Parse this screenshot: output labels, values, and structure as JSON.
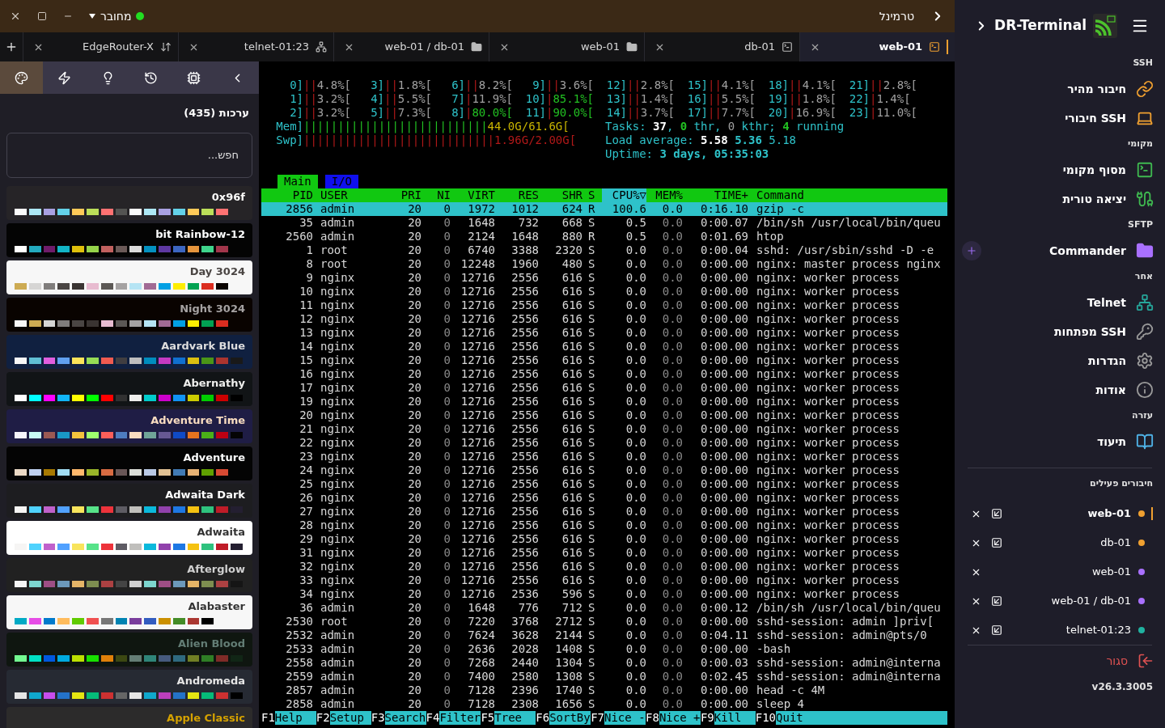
{
  "top_bar": {
    "title": "טרמינל",
    "status": "מחובר",
    "connected": true
  },
  "tabs": [
    {
      "label": "EdgeRouter-X",
      "kind": "arrows",
      "selected": false
    },
    {
      "label": "telnet-01:23",
      "kind": "network",
      "selected": false
    },
    {
      "label": "web-01 / db-01",
      "kind": "folder",
      "selected": false
    },
    {
      "label": "web-01",
      "kind": "folder",
      "selected": false
    },
    {
      "label": "db-01",
      "kind": "terminal",
      "selected": false
    },
    {
      "label": "web-01",
      "kind": "terminal",
      "selected": true
    }
  ],
  "theme_panel": {
    "tools": [
      {
        "kind": "palette",
        "selected": true
      },
      {
        "kind": "bolt",
        "selected": false
      },
      {
        "kind": "bulb",
        "selected": false
      },
      {
        "kind": "history",
        "selected": false
      },
      {
        "kind": "cpu",
        "selected": false
      },
      {
        "kind": "back",
        "selected": false
      }
    ],
    "heading": "ערכות (435)",
    "search_placeholder": "חפש...",
    "themes": [
      {
        "name": "0x96f",
        "color": "#262427",
        "foreground": {
          "color": "#fcfcfa"
        },
        "swatches": [
          {
            "color": "#fcfcfa"
          },
          {
            "color": "#aee8f4"
          },
          {
            "color": "#a9a1e1"
          },
          {
            "color": "#64d2e8"
          },
          {
            "color": "#ffca58"
          },
          {
            "color": "#bcdf59"
          },
          {
            "color": "#ff7272"
          },
          {
            "color": "#545452"
          },
          {
            "color": "#fcfcfa"
          },
          {
            "color": "#aee8f4"
          },
          {
            "color": "#a9a1e1"
          },
          {
            "color": "#64d2e8"
          },
          {
            "color": "#ffca58"
          },
          {
            "color": "#bcdf59"
          },
          {
            "color": "#ff7272"
          }
        ]
      },
      {
        "name": "bit Rainbow-12",
        "color": "#040404",
        "foreground": {
          "color": "#feffff"
        },
        "swatches": [
          {
            "color": "#ffffff"
          },
          {
            "color": "#23aabf"
          },
          {
            "color": "#6f1c6a"
          },
          {
            "color": "#12b5c6"
          },
          {
            "color": "#dfc00b"
          },
          {
            "color": "#95d34a"
          },
          {
            "color": "#c1615f"
          },
          {
            "color": "#6b5a58"
          },
          {
            "color": "#dbdbdb"
          },
          {
            "color": "#0391c0"
          },
          {
            "color": "#5e38a2"
          },
          {
            "color": "#3c66c1"
          },
          {
            "color": "#e5953d"
          },
          {
            "color": "#3fd58c"
          },
          {
            "color": "#a2364b"
          }
        ]
      },
      {
        "name": "Day 3024",
        "color": "#f7f7f7",
        "foreground": {
          "color": "#4a4543"
        },
        "swatches": [
          {
            "color": "#cdab53"
          },
          {
            "color": "#d6d5d4"
          },
          {
            "color": "#807d7c"
          },
          {
            "color": "#4a4543"
          },
          {
            "color": "#3a3432"
          },
          {
            "color": "#e8bbd0"
          },
          {
            "color": "#5c5855"
          },
          {
            "color": "#a5a2a2"
          },
          {
            "color": "#b5e4f4"
          },
          {
            "color": "#a16a94"
          },
          {
            "color": "#01a0e4"
          },
          {
            "color": "#fded02"
          },
          {
            "color": "#01a252"
          },
          {
            "color": "#db2d20"
          },
          {
            "color": "#090300"
          }
        ]
      },
      {
        "name": "Night 3024",
        "color": "#090300",
        "foreground": {
          "color": "#a5a2a2"
        },
        "swatches": [
          {
            "color": "#f7f7f7"
          },
          {
            "color": "#cdab53"
          },
          {
            "color": "#d6d5d4"
          },
          {
            "color": "#807d7c"
          },
          {
            "color": "#4a4543"
          },
          {
            "color": "#3a3432"
          },
          {
            "color": "#e8bbd0"
          },
          {
            "color": "#5c5855"
          },
          {
            "color": "#a5a2a2"
          },
          {
            "color": "#b5e4f4"
          },
          {
            "color": "#a16a94"
          },
          {
            "color": "#01a0e4"
          },
          {
            "color": "#fded02"
          },
          {
            "color": "#01a252"
          },
          {
            "color": "#db2d20"
          }
        ]
      },
      {
        "name": "Aardvark Blue",
        "color": "#102040",
        "foreground": {
          "color": "#dddddd"
        },
        "swatches": [
          {
            "color": "#f7f7f7"
          },
          {
            "color": "#60bfd4"
          },
          {
            "color": "#e05ede"
          },
          {
            "color": "#60a0f0"
          },
          {
            "color": "#fae359"
          },
          {
            "color": "#95dc55"
          },
          {
            "color": "#f05b50"
          },
          {
            "color": "#403e41"
          },
          {
            "color": "#bebebe"
          },
          {
            "color": "#008dbe"
          },
          {
            "color": "#c43ac3"
          },
          {
            "color": "#1070d0"
          },
          {
            "color": "#dbbf10"
          },
          {
            "color": "#4a9617"
          },
          {
            "color": "#aa342e"
          },
          {
            "color": "#191919"
          }
        ]
      },
      {
        "name": "Abernathy",
        "color": "#111416",
        "foreground": {
          "color": "#eeeeec"
        },
        "swatches": [
          {
            "color": "#ffffff"
          },
          {
            "color": "#00ffff"
          },
          {
            "color": "#ff00ff"
          },
          {
            "color": "#11b5f6"
          },
          {
            "color": "#ffff00"
          },
          {
            "color": "#00ff00"
          },
          {
            "color": "#ff0000"
          },
          {
            "color": "#313131"
          },
          {
            "color": "#eeeeec"
          },
          {
            "color": "#00cccc"
          },
          {
            "color": "#cc00cc"
          },
          {
            "color": "#1093f5"
          },
          {
            "color": "#cccc00"
          },
          {
            "color": "#00cd00"
          },
          {
            "color": "#cd0000"
          },
          {
            "color": "#000000"
          }
        ]
      },
      {
        "name": "Adventure Time",
        "color": "#1f1d45",
        "foreground": {
          "color": "#f8dcc0"
        },
        "swatches": [
          {
            "color": "#f6f5fb"
          },
          {
            "color": "#c8faf4"
          },
          {
            "color": "#9b5953"
          },
          {
            "color": "#1997c6"
          },
          {
            "color": "#f3c23d"
          },
          {
            "color": "#9eff6e"
          },
          {
            "color": "#fc5f5a"
          },
          {
            "color": "#4e7cbf"
          },
          {
            "color": "#f8dcc0"
          },
          {
            "color": "#70a598"
          },
          {
            "color": "#665993"
          },
          {
            "color": "#0f4ac6"
          },
          {
            "color": "#e7741e"
          },
          {
            "color": "#4ab118"
          },
          {
            "color": "#bd0013"
          },
          {
            "color": "#050404"
          }
        ]
      },
      {
        "name": "Adventure",
        "color": "#040404",
        "foreground": {
          "color": "#feffff"
        },
        "swatches": [
          {
            "color": "#ebd9c5"
          },
          {
            "color": "#bed0ef"
          },
          {
            "color": "#a67902"
          },
          {
            "color": "#a0dcf2"
          },
          {
            "color": "#feb86c"
          },
          {
            "color": "#99b529"
          },
          {
            "color": "#d76b42"
          },
          {
            "color": "#685656"
          },
          {
            "color": "#dbded8"
          },
          {
            "color": "#b9c9e4"
          },
          {
            "color": "#e1c193"
          },
          {
            "color": "#417ab3"
          },
          {
            "color": "#e7b274"
          },
          {
            "color": "#60a001"
          },
          {
            "color": "#d84a33"
          }
        ]
      },
      {
        "name": "Adwaita Dark",
        "color": "#1d1d20",
        "foreground": {
          "color": "#ffffff"
        },
        "swatches": [
          {
            "color": "#f6f5f4"
          },
          {
            "color": "#4fd2fd"
          },
          {
            "color": "#c061cb"
          },
          {
            "color": "#51a1ff"
          },
          {
            "color": "#f8e45c"
          },
          {
            "color": "#57e389"
          },
          {
            "color": "#ed333b"
          },
          {
            "color": "#5e5c64"
          },
          {
            "color": "#c0bfbc"
          },
          {
            "color": "#0ab9dc"
          },
          {
            "color": "#9141ac"
          },
          {
            "color": "#1e78e4"
          },
          {
            "color": "#f5c211"
          },
          {
            "color": "#2ec27e"
          },
          {
            "color": "#c01c28"
          },
          {
            "color": "#241f31"
          }
        ]
      },
      {
        "name": "Adwaita",
        "color": "#ffffff",
        "foreground": {
          "color": "#333333"
        },
        "swatches": [
          {
            "color": "#f6f5f4"
          },
          {
            "color": "#4fd2fd"
          },
          {
            "color": "#c061cb"
          },
          {
            "color": "#51a1ff"
          },
          {
            "color": "#f8e45c"
          },
          {
            "color": "#57e389"
          },
          {
            "color": "#ed333b"
          },
          {
            "color": "#5e5c64"
          },
          {
            "color": "#c0bfbc"
          },
          {
            "color": "#0ab9dc"
          },
          {
            "color": "#9141ac"
          },
          {
            "color": "#1e78e4"
          },
          {
            "color": "#f5c211"
          },
          {
            "color": "#2ec27e"
          },
          {
            "color": "#c01c28"
          },
          {
            "color": "#241f31"
          }
        ]
      },
      {
        "name": "Afterglow",
        "color": "#212121",
        "foreground": {
          "color": "#d0d0d0"
        },
        "swatches": [
          {
            "color": "#f5f5f5"
          },
          {
            "color": "#7dd6cf"
          },
          {
            "color": "#9e4e85"
          },
          {
            "color": "#6c99bb"
          },
          {
            "color": "#e5b567"
          },
          {
            "color": "#7e8e50"
          },
          {
            "color": "#ac4142"
          },
          {
            "color": "#444444"
          },
          {
            "color": "#d0d0d0"
          },
          {
            "color": "#7dd6cf"
          },
          {
            "color": "#9e4e85"
          },
          {
            "color": "#6c99bb"
          },
          {
            "color": "#e5b567"
          },
          {
            "color": "#7e8e50"
          },
          {
            "color": "#ac4142"
          },
          {
            "color": "#151515"
          }
        ]
      },
      {
        "name": "Alabaster",
        "color": "#f7f7f7",
        "foreground": {
          "color": "#333333"
        },
        "swatches": [
          {
            "color": "#00aac5"
          },
          {
            "color": "#e64ce6"
          },
          {
            "color": "#007acc"
          },
          {
            "color": "#ffbc5d"
          },
          {
            "color": "#60cb00"
          },
          {
            "color": "#f05050"
          },
          {
            "color": "#777777"
          },
          {
            "color": "#0083b2"
          },
          {
            "color": "#7a3e9d"
          },
          {
            "color": "#325cc0"
          },
          {
            "color": "#cb9000"
          },
          {
            "color": "#448c27"
          },
          {
            "color": "#aa3731"
          },
          {
            "color": "#000000"
          }
        ]
      },
      {
        "name": "Alien Blood",
        "color": "#0f1610",
        "foreground": {
          "color": "#637d75"
        },
        "swatches": [
          {
            "color": "#73fa91"
          },
          {
            "color": "#00e0c4"
          },
          {
            "color": "#0058e0"
          },
          {
            "color": "#00aae0"
          },
          {
            "color": "#bde000"
          },
          {
            "color": "#18e000"
          },
          {
            "color": "#e08009"
          },
          {
            "color": "#3c4812"
          },
          {
            "color": "#647d75"
          },
          {
            "color": "#2f8579"
          },
          {
            "color": "#465a7d"
          },
          {
            "color": "#2f6a7f"
          },
          {
            "color": "#717f24"
          },
          {
            "color": "#2f7e25"
          },
          {
            "color": "#7f2b27"
          },
          {
            "color": "#112616"
          }
        ]
      },
      {
        "name": "Andromeda",
        "color": "#262a33",
        "foreground": {
          "color": "#e5e5e5"
        },
        "swatches": [
          {
            "color": "#e5e5e5"
          },
          {
            "color": "#0fa8cd"
          },
          {
            "color": "#c74ded"
          },
          {
            "color": "#2472c8"
          },
          {
            "color": "#e5e512"
          },
          {
            "color": "#05bc79"
          },
          {
            "color": "#cd3131"
          },
          {
            "color": "#666666"
          },
          {
            "color": "#e5e5e5"
          },
          {
            "color": "#0fa8cd"
          },
          {
            "color": "#bc3fbc"
          },
          {
            "color": "#2472c8"
          },
          {
            "color": "#e5e512"
          },
          {
            "color": "#05bc79"
          },
          {
            "color": "#cd3131"
          },
          {
            "color": "#000000"
          }
        ]
      },
      {
        "name": "Apple Classic",
        "color": "#2c2b2b",
        "foreground": {
          "color": "#d5a200"
        }
      }
    ]
  },
  "htop": {
    "cpu_lines": [
      [
        {
          "label": "0]",
          "bars": "||",
          "value": "4.8%[",
          "color": "#a0a0a0"
        },
        {
          "label": "3]",
          "bars": "||",
          "value": "1.8%[",
          "color": "#a0a0a0"
        },
        {
          "label": "6]",
          "bars": "||",
          "value": "8.2%[",
          "color": "#a0a0a0"
        },
        {
          "label": "9]",
          "bars": "||",
          "value": "3.6%[",
          "color": "#a0a0a0"
        },
        {
          "label": "12]",
          "bars": "||",
          "value": "2.8%[",
          "color": "#a0a0a0"
        },
        {
          "label": "15]",
          "bars": "||",
          "value": "4.1%[",
          "color": "#a0a0a0"
        },
        {
          "label": "18]",
          "bars": "||",
          "value": "4.1%[",
          "color": "#a0a0a0"
        },
        {
          "label": "21]",
          "bars": "||",
          "value": "2.8%[",
          "color": "#a0a0a0"
        }
      ],
      [
        {
          "label": "1]",
          "bars": "||",
          "value": "3.2%[",
          "color": "#a0a0a0"
        },
        {
          "label": "4]",
          "bars": "||",
          "value": "5.5%[",
          "color": "#a0a0a0"
        },
        {
          "label": "7]",
          "bars": "|",
          "value": "11.9%[",
          "color": "#a0a0a0"
        },
        {
          "label": "10]",
          "bars": "|",
          "value": "85.1%[",
          "color": "#22c022"
        },
        {
          "label": "13]",
          "bars": "||",
          "value": "1.4%[",
          "color": "#a0a0a0"
        },
        {
          "label": "16]",
          "bars": "||",
          "value": "5.5%[",
          "color": "#a0a0a0"
        },
        {
          "label": "19]",
          "bars": "||",
          "value": "1.8%[",
          "color": "#a0a0a0"
        },
        {
          "label": "22]",
          "bars": "|",
          "value": "1.4%[",
          "color": "#a0a0a0"
        }
      ],
      [
        {
          "label": "2]",
          "bars": "||",
          "value": "3.2%[",
          "color": "#a0a0a0"
        },
        {
          "label": "5]",
          "bars": "||",
          "value": "7.3%[",
          "color": "#a0a0a0"
        },
        {
          "label": "8]",
          "bars": "|",
          "value": "80.0%[",
          "color": "#22c022"
        },
        {
          "label": "11]",
          "bars": "|",
          "value": "90.0%[",
          "color": "#22c022"
        },
        {
          "label": "14]",
          "bars": "||",
          "value": "3.7%[",
          "color": "#a0a0a0"
        },
        {
          "label": "17]",
          "bars": "||",
          "value": "7.7%[",
          "color": "#a0a0a0"
        },
        {
          "label": "20]",
          "bars": "|",
          "value": "16.9%[",
          "color": "#a0a0a0"
        },
        {
          "label": "23]",
          "bars": "|",
          "value": "11.0%[",
          "color": "#a0a0a0"
        }
      ]
    ],
    "memory_lines": [
      {
        "label": "Mem]",
        "bar": {
          "text": "|||||||||||||||||||||||||||",
          "color": "#22c022"
        },
        "value": "44.0G/61.6G[",
        "color": "#c8b400"
      },
      {
        "label": "Swp]",
        "bar": {
          "text": "||||||||||||||||||||||||||||",
          "color": "#b01818"
        },
        "value": "1.96G/2.00G[",
        "color": "#b01818"
      }
    ],
    "info_lines": [
      [
        {
          "text": "Tasks: ",
          "color": "#2ec2c9",
          "bold": false
        },
        {
          "text": "37",
          "color": "#ffffff",
          "bold": true
        },
        {
          "text": ", ",
          "color": "#2ec2c9",
          "bold": false
        },
        {
          "text": "0",
          "color": "#22c022",
          "bold": true
        },
        {
          "text": " thr, ",
          "color": "#2ec2c9",
          "bold": false
        },
        {
          "text": "0",
          "color": "#a0a0a0",
          "bold": false
        },
        {
          "text": " kthr; ",
          "color": "#2ec2c9",
          "bold": false
        },
        {
          "text": "4",
          "color": "#22c022",
          "bold": true
        },
        {
          "text": " running",
          "color": "#2ec2c9",
          "bold": false
        }
      ],
      [
        {
          "text": "Load average: ",
          "color": "#2ec2c9",
          "bold": false
        },
        {
          "text": "5.58 ",
          "color": "#ffffff",
          "bold": true
        },
        {
          "text": "5.36 ",
          "color": "#2ec2c9",
          "bold": true
        },
        {
          "text": "5.18",
          "color": "#2ec2c9",
          "bold": false
        }
      ],
      [
        {
          "text": "Uptime: ",
          "color": "#2ec2c9",
          "bold": false
        },
        {
          "text": "3 days, 05:35:03",
          "color": "#2ec2c9",
          "bold": true
        }
      ]
    ],
    "screen_tabs": [
      {
        "label": "Main",
        "selected": true
      },
      {
        "label": "I/O",
        "selected": false
      }
    ],
    "columns": [
      {
        "label": "PID",
        "selected": false
      },
      {
        "label": "USER",
        "selected": false
      },
      {
        "label": "PRI",
        "selected": false
      },
      {
        "label": "NI",
        "selected": false
      },
      {
        "label": "VIRT",
        "selected": false
      },
      {
        "label": "RES",
        "selected": false
      },
      {
        "label": "SHR",
        "selected": false
      },
      {
        "label": "S",
        "selected": false
      },
      {
        "label": "CPU%",
        "selected": true,
        "sort_icon": "▽"
      },
      {
        "label": "MEM%",
        "selected": false
      },
      {
        "label": "TIME+",
        "selected": false
      },
      {
        "label": "Command",
        "selected": false
      }
    ],
    "rows": [
      {
        "pid": "2856",
        "user": "admin",
        "pri": "20",
        "ni": "0",
        "virt": "1972",
        "res": "1012",
        "shr": "624",
        "s": "R",
        "cpu": "100.6",
        "mem": "0.0",
        "time": "0:16.10",
        "command": "gzip -c",
        "selected": true
      },
      {
        "pid": "35",
        "user": "admin",
        "pri": "20",
        "ni": "0",
        "virt": "1648",
        "res": "732",
        "shr": "668",
        "s": "S",
        "cpu": "0.5",
        "mem": "0.0",
        "time": "0:00.07",
        "command": "/bin/sh /usr/local/bin/queu",
        "selected": false
      },
      {
        "pid": "2560",
        "user": "admin",
        "pri": "20",
        "ni": "0",
        "virt": "2124",
        "res": "1648",
        "shr": "880",
        "s": "R",
        "cpu": "0.5",
        "mem": "0.0",
        "time": "0:01.69",
        "command": "htop",
        "selected": false
      },
      {
        "pid": "1",
        "user": "root",
        "pri": "20",
        "ni": "0",
        "virt": "6740",
        "res": "3388",
        "shr": "2320",
        "s": "S",
        "cpu": "0.0",
        "mem": "0.0",
        "time": "0:00.04",
        "command": "sshd: /usr/sbin/sshd -D -e",
        "selected": false
      },
      {
        "pid": "8",
        "user": "root",
        "pri": "20",
        "ni": "0",
        "virt": "12248",
        "res": "1960",
        "shr": "480",
        "s": "S",
        "cpu": "0.0",
        "mem": "0.0",
        "time": "0:00.00",
        "command": "nginx: master process nginx",
        "selected": false
      },
      {
        "pid": "9",
        "user": "nginx",
        "pri": "20",
        "ni": "0",
        "virt": "12716",
        "res": "2556",
        "shr": "616",
        "s": "S",
        "cpu": "0.0",
        "mem": "0.0",
        "time": "0:00.00",
        "command": "nginx: worker process",
        "selected": false
      },
      {
        "pid": "10",
        "user": "nginx",
        "pri": "20",
        "ni": "0",
        "virt": "12716",
        "res": "2556",
        "shr": "616",
        "s": "S",
        "cpu": "0.0",
        "mem": "0.0",
        "time": "0:00.00",
        "command": "nginx: worker process",
        "selected": false
      },
      {
        "pid": "11",
        "user": "nginx",
        "pri": "20",
        "ni": "0",
        "virt": "12716",
        "res": "2556",
        "shr": "616",
        "s": "S",
        "cpu": "0.0",
        "mem": "0.0",
        "time": "0:00.00",
        "command": "nginx: worker process",
        "selected": false
      },
      {
        "pid": "12",
        "user": "nginx",
        "pri": "20",
        "ni": "0",
        "virt": "12716",
        "res": "2556",
        "shr": "616",
        "s": "S",
        "cpu": "0.0",
        "mem": "0.0",
        "time": "0:00.00",
        "command": "nginx: worker process",
        "selected": false
      },
      {
        "pid": "13",
        "user": "nginx",
        "pri": "20",
        "ni": "0",
        "virt": "12716",
        "res": "2556",
        "shr": "616",
        "s": "S",
        "cpu": "0.0",
        "mem": "0.0",
        "time": "0:00.00",
        "command": "nginx: worker process",
        "selected": false
      },
      {
        "pid": "14",
        "user": "nginx",
        "pri": "20",
        "ni": "0",
        "virt": "12716",
        "res": "2556",
        "shr": "616",
        "s": "S",
        "cpu": "0.0",
        "mem": "0.0",
        "time": "0:00.00",
        "command": "nginx: worker process",
        "selected": false
      },
      {
        "pid": "15",
        "user": "nginx",
        "pri": "20",
        "ni": "0",
        "virt": "12716",
        "res": "2556",
        "shr": "616",
        "s": "S",
        "cpu": "0.0",
        "mem": "0.0",
        "time": "0:00.00",
        "command": "nginx: worker process",
        "selected": false
      },
      {
        "pid": "16",
        "user": "nginx",
        "pri": "20",
        "ni": "0",
        "virt": "12716",
        "res": "2556",
        "shr": "616",
        "s": "S",
        "cpu": "0.0",
        "mem": "0.0",
        "time": "0:00.00",
        "command": "nginx: worker process",
        "selected": false
      },
      {
        "pid": "17",
        "user": "nginx",
        "pri": "20",
        "ni": "0",
        "virt": "12716",
        "res": "2556",
        "shr": "616",
        "s": "S",
        "cpu": "0.0",
        "mem": "0.0",
        "time": "0:00.00",
        "command": "nginx: worker process",
        "selected": false
      },
      {
        "pid": "19",
        "user": "nginx",
        "pri": "20",
        "ni": "0",
        "virt": "12716",
        "res": "2556",
        "shr": "616",
        "s": "S",
        "cpu": "0.0",
        "mem": "0.0",
        "time": "0:00.00",
        "command": "nginx: worker process",
        "selected": false
      },
      {
        "pid": "20",
        "user": "nginx",
        "pri": "20",
        "ni": "0",
        "virt": "12716",
        "res": "2556",
        "shr": "616",
        "s": "S",
        "cpu": "0.0",
        "mem": "0.0",
        "time": "0:00.00",
        "command": "nginx: worker process",
        "selected": false
      },
      {
        "pid": "21",
        "user": "nginx",
        "pri": "20",
        "ni": "0",
        "virt": "12716",
        "res": "2556",
        "shr": "616",
        "s": "S",
        "cpu": "0.0",
        "mem": "0.0",
        "time": "0:00.00",
        "command": "nginx: worker process",
        "selected": false
      },
      {
        "pid": "22",
        "user": "nginx",
        "pri": "20",
        "ni": "0",
        "virt": "12716",
        "res": "2556",
        "shr": "616",
        "s": "S",
        "cpu": "0.0",
        "mem": "0.0",
        "time": "0:00.00",
        "command": "nginx: worker process",
        "selected": false
      },
      {
        "pid": "23",
        "user": "nginx",
        "pri": "20",
        "ni": "0",
        "virt": "12716",
        "res": "2556",
        "shr": "616",
        "s": "S",
        "cpu": "0.0",
        "mem": "0.0",
        "time": "0:00.00",
        "command": "nginx: worker process",
        "selected": false
      },
      {
        "pid": "24",
        "user": "nginx",
        "pri": "20",
        "ni": "0",
        "virt": "12716",
        "res": "2556",
        "shr": "616",
        "s": "S",
        "cpu": "0.0",
        "mem": "0.0",
        "time": "0:00.00",
        "command": "nginx: worker process",
        "selected": false
      },
      {
        "pid": "25",
        "user": "nginx",
        "pri": "20",
        "ni": "0",
        "virt": "12716",
        "res": "2556",
        "shr": "616",
        "s": "S",
        "cpu": "0.0",
        "mem": "0.0",
        "time": "0:00.00",
        "command": "nginx: worker process",
        "selected": false
      },
      {
        "pid": "26",
        "user": "nginx",
        "pri": "20",
        "ni": "0",
        "virt": "12716",
        "res": "2556",
        "shr": "616",
        "s": "S",
        "cpu": "0.0",
        "mem": "0.0",
        "time": "0:00.00",
        "command": "nginx: worker process",
        "selected": false
      },
      {
        "pid": "27",
        "user": "nginx",
        "pri": "20",
        "ni": "0",
        "virt": "12716",
        "res": "2556",
        "shr": "616",
        "s": "S",
        "cpu": "0.0",
        "mem": "0.0",
        "time": "0:00.00",
        "command": "nginx: worker process",
        "selected": false
      },
      {
        "pid": "28",
        "user": "nginx",
        "pri": "20",
        "ni": "0",
        "virt": "12716",
        "res": "2556",
        "shr": "616",
        "s": "S",
        "cpu": "0.0",
        "mem": "0.0",
        "time": "0:00.00",
        "command": "nginx: worker process",
        "selected": false
      },
      {
        "pid": "29",
        "user": "nginx",
        "pri": "20",
        "ni": "0",
        "virt": "12716",
        "res": "2556",
        "shr": "616",
        "s": "S",
        "cpu": "0.0",
        "mem": "0.0",
        "time": "0:00.00",
        "command": "nginx: worker process",
        "selected": false
      },
      {
        "pid": "31",
        "user": "nginx",
        "pri": "20",
        "ni": "0",
        "virt": "12716",
        "res": "2556",
        "shr": "616",
        "s": "S",
        "cpu": "0.0",
        "mem": "0.0",
        "time": "0:00.00",
        "command": "nginx: worker process",
        "selected": false
      },
      {
        "pid": "32",
        "user": "nginx",
        "pri": "20",
        "ni": "0",
        "virt": "12716",
        "res": "2556",
        "shr": "616",
        "s": "S",
        "cpu": "0.0",
        "mem": "0.0",
        "time": "0:00.00",
        "command": "nginx: worker process",
        "selected": false
      },
      {
        "pid": "33",
        "user": "nginx",
        "pri": "20",
        "ni": "0",
        "virt": "12716",
        "res": "2556",
        "shr": "616",
        "s": "S",
        "cpu": "0.0",
        "mem": "0.0",
        "time": "0:00.00",
        "command": "nginx: worker process",
        "selected": false
      },
      {
        "pid": "34",
        "user": "nginx",
        "pri": "20",
        "ni": "0",
        "virt": "12716",
        "res": "2536",
        "shr": "596",
        "s": "S",
        "cpu": "0.0",
        "mem": "0.0",
        "time": "0:00.00",
        "command": "nginx: worker process",
        "selected": false
      },
      {
        "pid": "36",
        "user": "admin",
        "pri": "20",
        "ni": "0",
        "virt": "1648",
        "res": "776",
        "shr": "712",
        "s": "S",
        "cpu": "0.0",
        "mem": "0.0",
        "time": "0:00.12",
        "command": "/bin/sh /usr/local/bin/queu",
        "selected": false
      },
      {
        "pid": "2530",
        "user": "root",
        "pri": "20",
        "ni": "0",
        "virt": "7220",
        "res": "3768",
        "shr": "2712",
        "s": "S",
        "cpu": "0.0",
        "mem": "0.0",
        "time": "0:00.00",
        "command": "sshd-session: admin ]priv[",
        "selected": false
      },
      {
        "pid": "2532",
        "user": "admin",
        "pri": "20",
        "ni": "0",
        "virt": "7624",
        "res": "3628",
        "shr": "2144",
        "s": "S",
        "cpu": "0.0",
        "mem": "0.0",
        "time": "0:04.11",
        "command": "sshd-session: admin@pts/0",
        "selected": false
      },
      {
        "pid": "2533",
        "user": "admin",
        "pri": "20",
        "ni": "0",
        "virt": "2636",
        "res": "2028",
        "shr": "1408",
        "s": "S",
        "cpu": "0.0",
        "mem": "0.0",
        "time": "0:00.00",
        "command": "-bash",
        "selected": false
      },
      {
        "pid": "2558",
        "user": "admin",
        "pri": "20",
        "ni": "0",
        "virt": "7268",
        "res": "2440",
        "shr": "1304",
        "s": "S",
        "cpu": "0.0",
        "mem": "0.0",
        "time": "0:00.03",
        "command": "sshd-session: admin@interna",
        "selected": false
      },
      {
        "pid": "2559",
        "user": "admin",
        "pri": "20",
        "ni": "0",
        "virt": "7400",
        "res": "2580",
        "shr": "1308",
        "s": "S",
        "cpu": "0.0",
        "mem": "0.0",
        "time": "0:02.45",
        "command": "sshd-session: admin@interna",
        "selected": false
      },
      {
        "pid": "2857",
        "user": "admin",
        "pri": "20",
        "ni": "0",
        "virt": "7128",
        "res": "2396",
        "shr": "1740",
        "s": "S",
        "cpu": "0.0",
        "mem": "0.0",
        "time": "0:00.00",
        "command": "head -c 4M",
        "selected": false
      },
      {
        "pid": "2858",
        "user": "admin",
        "pri": "20",
        "ni": "0",
        "virt": "7128",
        "res": "2308",
        "shr": "1656",
        "s": "S",
        "cpu": "0.0",
        "mem": "0.0",
        "time": "0:00.00",
        "command": "sleep 4",
        "selected": false
      }
    ],
    "function_keys": [
      {
        "key": "F1",
        "label": "Help"
      },
      {
        "key": "F2",
        "label": "Setup"
      },
      {
        "key": "F3",
        "label": "Search"
      },
      {
        "key": "F4",
        "label": "Filter"
      },
      {
        "key": "F5",
        "label": "Tree"
      },
      {
        "key": "F6",
        "label": "SortBy"
      },
      {
        "key": "F7",
        "label": "Nice -"
      },
      {
        "key": "F8",
        "label": "Nice +"
      },
      {
        "key": "F9",
        "label": "Kill"
      },
      {
        "key": "F10",
        "label": "Quit"
      }
    ]
  },
  "sidebar": {
    "title": "DR-Terminal",
    "sections": [
      {
        "heading": "SSH",
        "items": [
          {
            "label": "חיבור מהיר",
            "kind": "link",
            "color": "#f0a030"
          },
          {
            "label": "חיבורי SSH",
            "kind": "laptop",
            "color": "#f0a030"
          }
        ]
      },
      {
        "heading": "מקומי",
        "items": [
          {
            "label": "מסוף מקומי",
            "kind": "terminal",
            "color": "#3fb950"
          },
          {
            "label": "יציאה טורית",
            "kind": "cable",
            "color": "#3fb950"
          }
        ]
      },
      {
        "heading": "SFTP",
        "items": [
          {
            "label": "Commander",
            "kind": "folder",
            "color": "#a970ff",
            "add_button": true
          }
        ]
      },
      {
        "heading": "אחר",
        "items": [
          {
            "label": "Telnet",
            "kind": "network",
            "color": "#26a69a"
          },
          {
            "label": "מפתחות SSH",
            "kind": "key",
            "color": "#9a9a9a"
          },
          {
            "label": "הגדרות",
            "kind": "gear",
            "color": "#9a9a9a"
          },
          {
            "label": "אודות",
            "kind": "info",
            "color": "#9a9a9a"
          }
        ]
      },
      {
        "heading": "עזרה",
        "items": [
          {
            "label": "תיעוד",
            "kind": "book",
            "color": "#4fb3e8"
          }
        ]
      }
    ],
    "active_heading": "חיבורים פעילים",
    "connections": [
      {
        "name": "web-01",
        "color": "#f0a030",
        "selected": true,
        "detachable": true
      },
      {
        "name": "db-01",
        "color": "#f0a030",
        "selected": false,
        "detachable": true
      },
      {
        "name": "web-01",
        "color": "#a970ff",
        "selected": false,
        "detachable": false
      },
      {
        "name": "web-01 / db-01",
        "color": "#a970ff",
        "selected": false,
        "detachable": true
      },
      {
        "name": "telnet-01:23",
        "color": "#20b2a0",
        "selected": false,
        "detachable": true
      }
    ],
    "close_label": "סגור",
    "version": "v26.3.3005"
  }
}
